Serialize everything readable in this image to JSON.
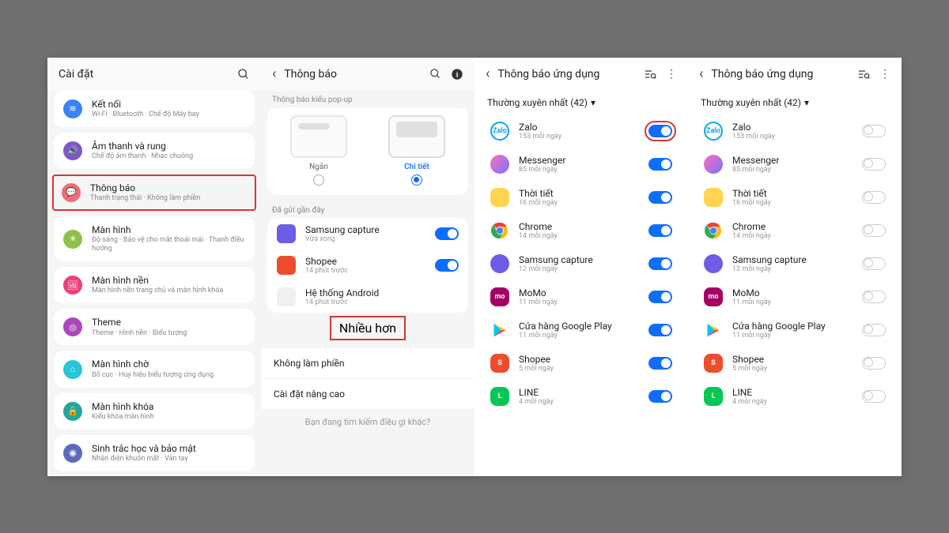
{
  "panel1": {
    "title": "Cài đặt",
    "items": [
      {
        "title": "Kết nối",
        "sub": "Wi-Fi · Bluetooth · Chế độ Máy bay",
        "color": "#3b82f6",
        "icon": "≋"
      },
      {
        "title": "Âm thanh và rung",
        "sub": "Chế độ âm thanh · Nhạc chuông",
        "color": "#7e57c2",
        "icon": "🔊"
      },
      {
        "title": "Thông báo",
        "sub": "Thanh trạng thái · Không làm phiền",
        "color": "#ee6e73",
        "icon": "💬",
        "highlight": true
      },
      {
        "title": "Màn hình",
        "sub": "Độ sáng · Bảo vệ cho mắt thoải mái · Thanh điều hướng",
        "color": "#8bc34a",
        "icon": "☀"
      },
      {
        "title": "Màn hình nền",
        "sub": "Màn hình nền trang chủ và màn hình khóa",
        "color": "#ec407a",
        "icon": "🖼"
      },
      {
        "title": "Theme",
        "sub": "Theme · Hình nền · Biểu tượng",
        "color": "#ab47bc",
        "icon": "◎"
      },
      {
        "title": "Màn hình chờ",
        "sub": "Bố cục · Huy hiệu biểu tượng ứng dụng",
        "color": "#26c6da",
        "icon": "⌂"
      },
      {
        "title": "Màn hình khóa",
        "sub": "Kiểu khóa màn hình",
        "color": "#26a69a",
        "icon": "🔒"
      },
      {
        "title": "Sinh trắc học và bảo mật",
        "sub": "Nhận diện khuôn mặt · Vân tay",
        "color": "#5c6bc0",
        "icon": "◉"
      }
    ]
  },
  "panel2": {
    "title": "Thông báo",
    "popup_label": "Thông báo kiểu pop-up",
    "short": "Ngắn",
    "detail": "Chi tiết",
    "recent_label": "Đã gửi gần đây",
    "recent": [
      {
        "name": "Samsung capture",
        "sub": "Vừa xong",
        "color": "#6c5ce7",
        "on": true
      },
      {
        "name": "Shopee",
        "sub": "14 phút trước",
        "color": "#ee4d2d",
        "on": true
      },
      {
        "name": "Hệ thống Android",
        "sub": "14 phút trước",
        "color": "#f0f0f0",
        "on": false
      }
    ],
    "more": "Nhiều hơn",
    "dnd": "Không làm phiền",
    "advanced": "Cài đặt nâng cao",
    "footer": "Bạn đang tìm kiếm điều gì khác?"
  },
  "panel3": {
    "title": "Thông báo ứng dụng",
    "filter": "Thường xuyên nhất (42)",
    "apps": [
      {
        "name": "Zalo",
        "sub": "153 mỗi ngày",
        "cls": "ic-zalo",
        "txt": "Zalo"
      },
      {
        "name": "Messenger",
        "sub": "85 mỗi ngày",
        "cls": "ic-msg",
        "txt": ""
      },
      {
        "name": "Thời tiết",
        "sub": "16 mỗi ngày",
        "cls": "ic-weather",
        "txt": ""
      },
      {
        "name": "Chrome",
        "sub": "14 mỗi ngày",
        "cls": "ic-chrome",
        "txt": ""
      },
      {
        "name": "Samsung capture",
        "sub": "12 mỗi ngày",
        "cls": "ic-capture",
        "txt": ""
      },
      {
        "name": "MoMo",
        "sub": "11 mỗi ngày",
        "cls": "ic-momo",
        "txt": "mo"
      },
      {
        "name": "Cửa hàng Google Play",
        "sub": "11 mỗi ngày",
        "cls": "ic-play",
        "txt": "▶"
      },
      {
        "name": "Shopee",
        "sub": "5 mỗi ngày",
        "cls": "ic-shopee",
        "txt": "S"
      },
      {
        "name": "LINE",
        "sub": "4 mỗi ngày",
        "cls": "ic-line",
        "txt": "L"
      }
    ]
  }
}
